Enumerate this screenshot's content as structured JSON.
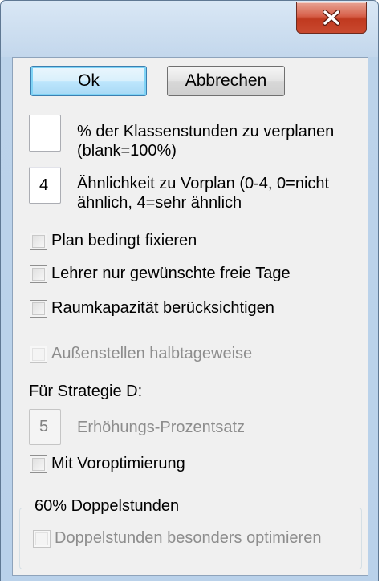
{
  "window": {
    "close_icon": "close-x-icon",
    "close_color": "#c9492f"
  },
  "buttons": {
    "ok": "Ok",
    "cancel": "Abbrechen"
  },
  "fields": {
    "percent": {
      "value": "",
      "label": "% der Klassenstunden zu verplanen (blank=100%)"
    },
    "similarity": {
      "value": "4",
      "label": "Ähnlichkeit zu Vorplan (0-4, 0=nicht ähnlich, 4=sehr ähnlich"
    },
    "increase": {
      "value": "5",
      "label": "Erhöhungs-Prozentsatz"
    }
  },
  "checkboxes": {
    "fix_plan": {
      "label": "Plan bedingt fixieren",
      "checked": false
    },
    "teacher_free_days": {
      "label": "Lehrer nur gewünschte freie Tage",
      "checked": false
    },
    "room_capacity": {
      "label": "Raumkapazität berücksichtigen",
      "checked": false
    },
    "half_day": {
      "label": "Außenstellen halbtageweise",
      "checked": false,
      "enabled": false
    },
    "preoptimize": {
      "label": "Mit Voroptimierung",
      "checked": false
    },
    "double_lessons": {
      "label": "Doppelstunden besonders optimieren",
      "checked": false,
      "enabled": false
    }
  },
  "strategy": {
    "heading": "Für Strategie D:"
  },
  "group": {
    "title": "60% Doppelstunden"
  }
}
